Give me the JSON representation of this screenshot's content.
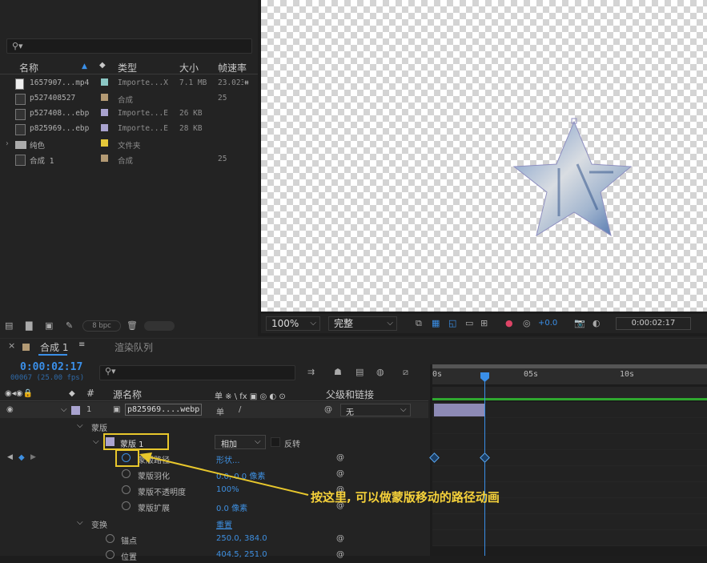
{
  "project": {
    "search_placeholder": "",
    "columns": {
      "name": "名称",
      "type": "类型",
      "size": "大小",
      "fps": "帧速率"
    },
    "items": [
      {
        "name": "1657907...mp4",
        "type": "Importe...X",
        "size": "7.1 MB",
        "fps": "23.023",
        "label": "#8bc7c4",
        "icon": "document-icon"
      },
      {
        "name": "p527408527",
        "type": "合成",
        "size": "",
        "fps": "25",
        "label": "#b39a74",
        "icon": "composition-icon"
      },
      {
        "name": "p527408...ebp",
        "type": "Importe...E",
        "size": "26 KB",
        "fps": "",
        "label": "#a9a3cf",
        "icon": "image-icon"
      },
      {
        "name": "p825969...ebp",
        "type": "Importe...E",
        "size": "28 KB",
        "fps": "",
        "label": "#a9a3cf",
        "icon": "image-icon"
      },
      {
        "name": "纯色",
        "type": "文件夹",
        "size": "",
        "fps": "",
        "label": "#e5c83a",
        "icon": "folder-icon"
      },
      {
        "name": "合成 1",
        "type": "合成",
        "size": "",
        "fps": "25",
        "label": "#b39a74",
        "icon": "composition-icon"
      }
    ],
    "bpc": "8 bpc"
  },
  "viewer": {
    "zoom": "100%",
    "quality": "完整",
    "exposure": "+0.0",
    "timecode": "0:00:02:17"
  },
  "timeline": {
    "tab_comp": "合成 1",
    "tab_render": "渲染队列",
    "timecode": "0:00:02:17",
    "frames": "00067 (25.00 fps)",
    "col_hash": "#",
    "col_source": "源名称",
    "col_switches": "单 ※ \\ fx ▣ ◎ ◐ ⊙",
    "col_parent": "父级和链接",
    "ruler": [
      "0s",
      "05s",
      "10s"
    ],
    "layer": {
      "index": "1",
      "name": "p825969....webp",
      "parent": "无"
    },
    "mask_group": "蒙版",
    "mask": {
      "name": "蒙版 1",
      "mode": "相加",
      "invert": "反转"
    },
    "props": [
      {
        "name": "蒙版路径",
        "value": "形状..."
      },
      {
        "name": "蒙版羽化",
        "value": "0.0, 0.0 像素"
      },
      {
        "name": "蒙版不透明度",
        "value": "100%"
      },
      {
        "name": "蒙版扩展",
        "value": "0.0 像素"
      }
    ],
    "transform": {
      "name": "变换",
      "reset": "重置"
    },
    "tprops": [
      {
        "name": "锚点",
        "value": "250.0, 384.0"
      },
      {
        "name": "位置",
        "value": "404.5, 251.0"
      }
    ]
  },
  "annotation": "按这里, 可以做蒙版移动的路径动画"
}
